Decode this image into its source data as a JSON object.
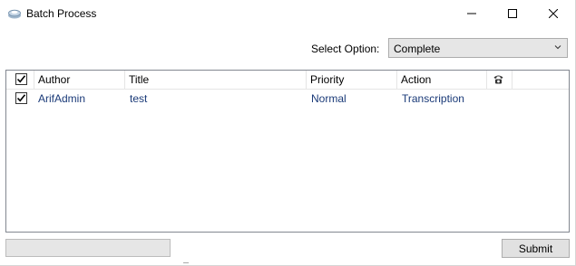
{
  "window": {
    "title": "Batch Process",
    "icon": "cloud-stack-icon"
  },
  "options": {
    "label": "Select Option:",
    "selected": "Complete"
  },
  "grid": {
    "columns": [
      "Author",
      "Title",
      "Priority",
      "Action"
    ],
    "rows": [
      {
        "checked": true,
        "author": "ArifAdmin",
        "title": "test",
        "priority": "Normal",
        "action": "Transcription"
      }
    ]
  },
  "progress": {
    "value": 0
  },
  "submit_label": "Submit",
  "colors": {
    "cell_text": "#1a3a78",
    "button_bg": "#e1e1e1"
  }
}
